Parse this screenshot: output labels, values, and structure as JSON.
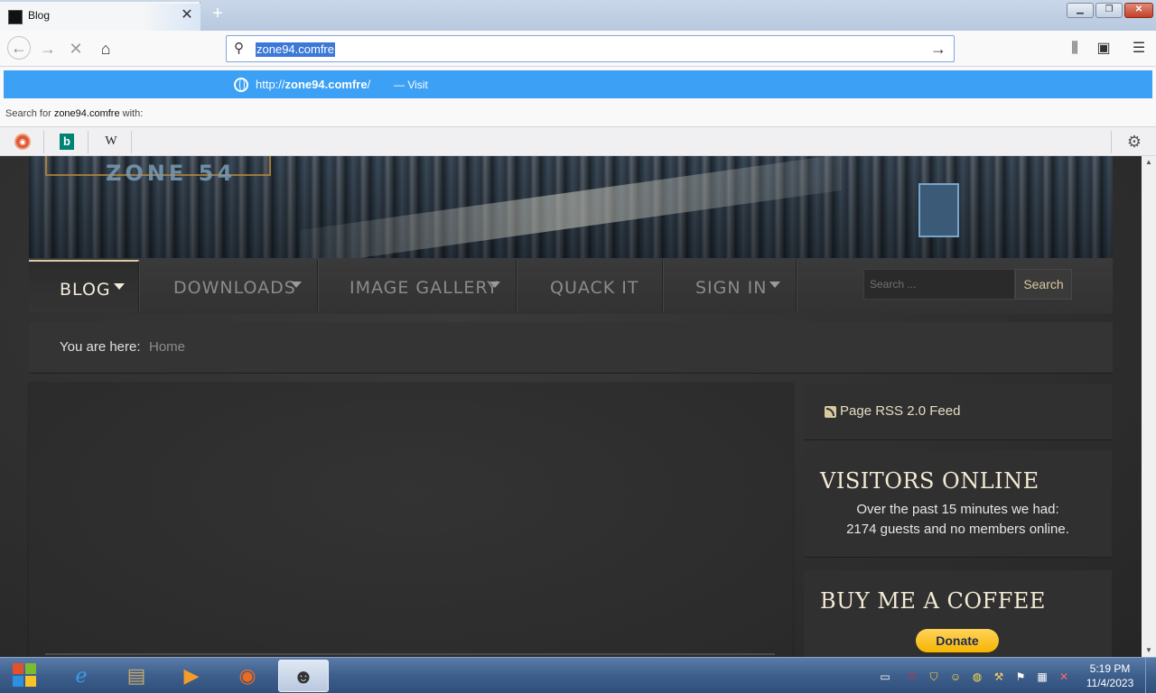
{
  "browser": {
    "tab_title": "Blog",
    "tab_close": "✕",
    "new_tab": "+",
    "url_value": "zone94.comfre",
    "suggestion": {
      "url_prefix": "http://",
      "url_bold": "zone94.comfre",
      "url_suffix": "/",
      "visit_label": "— Visit"
    },
    "search_with_prefix": "Search for",
    "search_with_term": "zone94.comfre",
    "search_with_suffix": "with:",
    "engines": [
      "duckduckgo-icon",
      "bing-icon",
      "wikipedia-icon"
    ],
    "engine_labels": {
      "bing": "b",
      "wiki": "W"
    }
  },
  "site": {
    "banner_logo": "ZONE 54",
    "menu": [
      {
        "label": "BLOG",
        "has_dropdown": true,
        "active": true
      },
      {
        "label": "DOWNLOADS",
        "has_dropdown": true,
        "active": false
      },
      {
        "label": "IMAGE GALLERY",
        "has_dropdown": true,
        "active": false
      },
      {
        "label": "QUACK IT",
        "has_dropdown": false,
        "active": false
      },
      {
        "label": "SIGN IN",
        "has_dropdown": true,
        "active": false
      }
    ],
    "search_placeholder": "Search ...",
    "search_button": "Search",
    "breadcrumb_label": "You are here:",
    "breadcrumb_home": "Home",
    "rss_label": "Page RSS 2.0 Feed",
    "visitors_title": "VISITORS ONLINE",
    "visitors_line1": "Over the past 15 minutes we had:",
    "visitors_line2": "2174 guests and no members online.",
    "coffee_title": "BUY ME A COFFEE",
    "donate_label": "Donate"
  },
  "taskbar": {
    "time": "5:19 PM",
    "date": "11/4/2023"
  },
  "colors": {
    "accent_blue": "#3ca0f5",
    "menu_active": "#f2ecdd",
    "gold_text": "#d9c9a0",
    "donate_yellow": "#f7b500"
  }
}
